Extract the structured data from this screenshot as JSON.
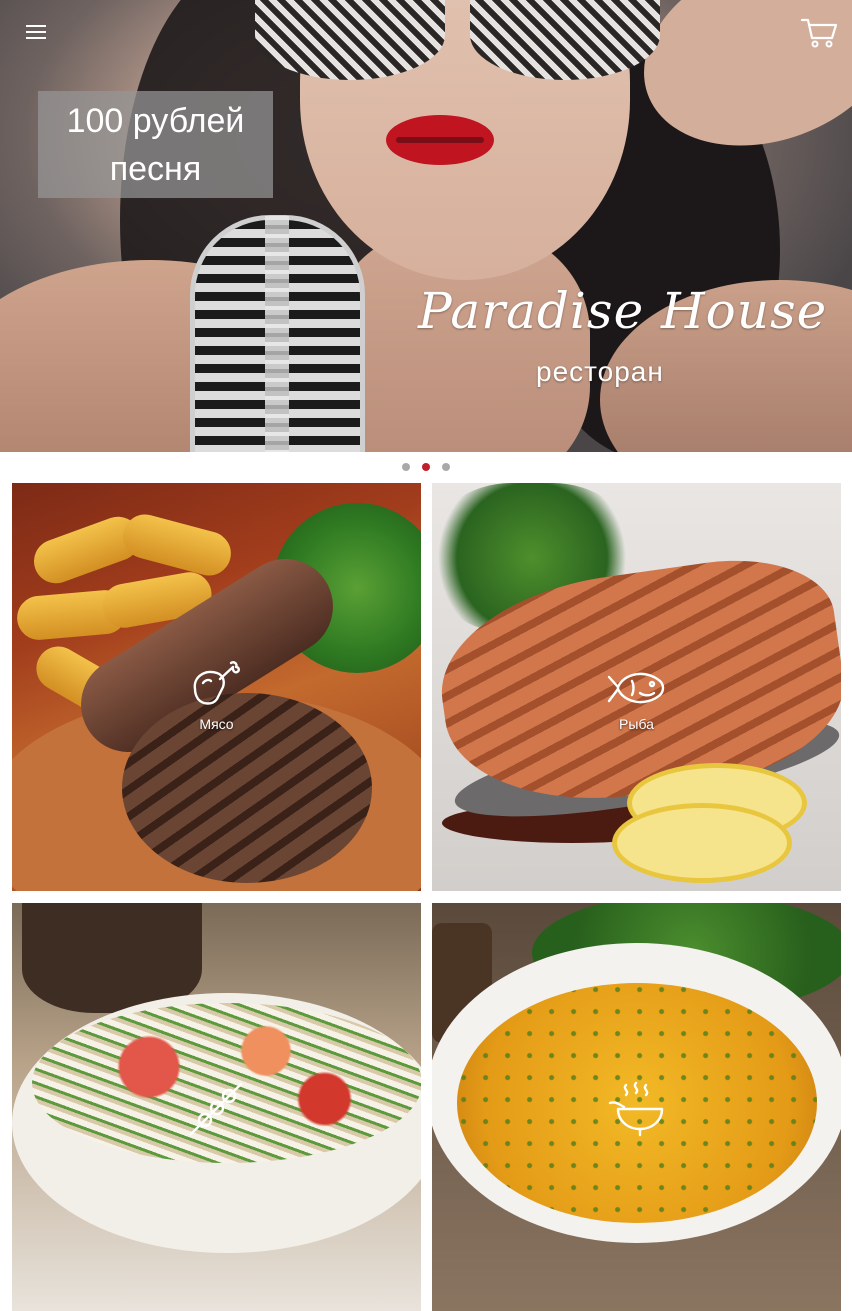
{
  "header": {
    "menu_icon": "hamburger-menu-icon",
    "cart_icon": "shopping-cart-icon"
  },
  "banner": {
    "promo_line1": "100 рублей",
    "promo_line2": "песня",
    "brand_name": "Paradise House",
    "brand_subtitle": "ресторан"
  },
  "carousel": {
    "pages": 3,
    "active_page": 2
  },
  "categories": [
    {
      "label": "Мясо",
      "icon": "chicken-leg-icon"
    },
    {
      "label": "Рыба",
      "icon": "fish-icon"
    },
    {
      "label": "",
      "icon": "skewer-icon"
    },
    {
      "label": "",
      "icon": "pan-icon"
    }
  ],
  "colors": {
    "accent": "#c0202a",
    "dot_inactive": "#a9a9a9",
    "text_on_image": "#ffffff"
  }
}
